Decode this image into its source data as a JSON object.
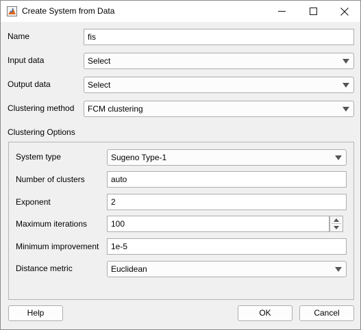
{
  "window": {
    "title": "Create System from Data"
  },
  "controls": {
    "minimize_icon": "minimize-icon",
    "maximize_icon": "maximize-icon",
    "close_icon": "close-icon"
  },
  "form": {
    "name_label": "Name",
    "name_value": "fis",
    "input_label": "Input data",
    "input_value": "Select",
    "output_label": "Output data",
    "output_value": "Select",
    "method_label": "Clustering method",
    "method_value": "FCM clustering"
  },
  "options": {
    "heading": "Clustering Options",
    "system_type_label": "System type",
    "system_type_value": "Sugeno Type-1",
    "clusters_label": "Number of clusters",
    "clusters_value": "auto",
    "exponent_label": "Exponent",
    "exponent_value": "2",
    "iterations_label": "Maximum iterations",
    "iterations_value": "100",
    "improvement_label": "Minimum improvement",
    "improvement_value": "1e-5",
    "distance_label": "Distance metric",
    "distance_value": "Euclidean"
  },
  "buttons": {
    "help": "Help",
    "ok": "OK",
    "cancel": "Cancel"
  },
  "colors": {
    "background": "#f0f0f0",
    "titlebar": "#ffffff",
    "border": "#adadad",
    "accent": "#e06b1e"
  }
}
